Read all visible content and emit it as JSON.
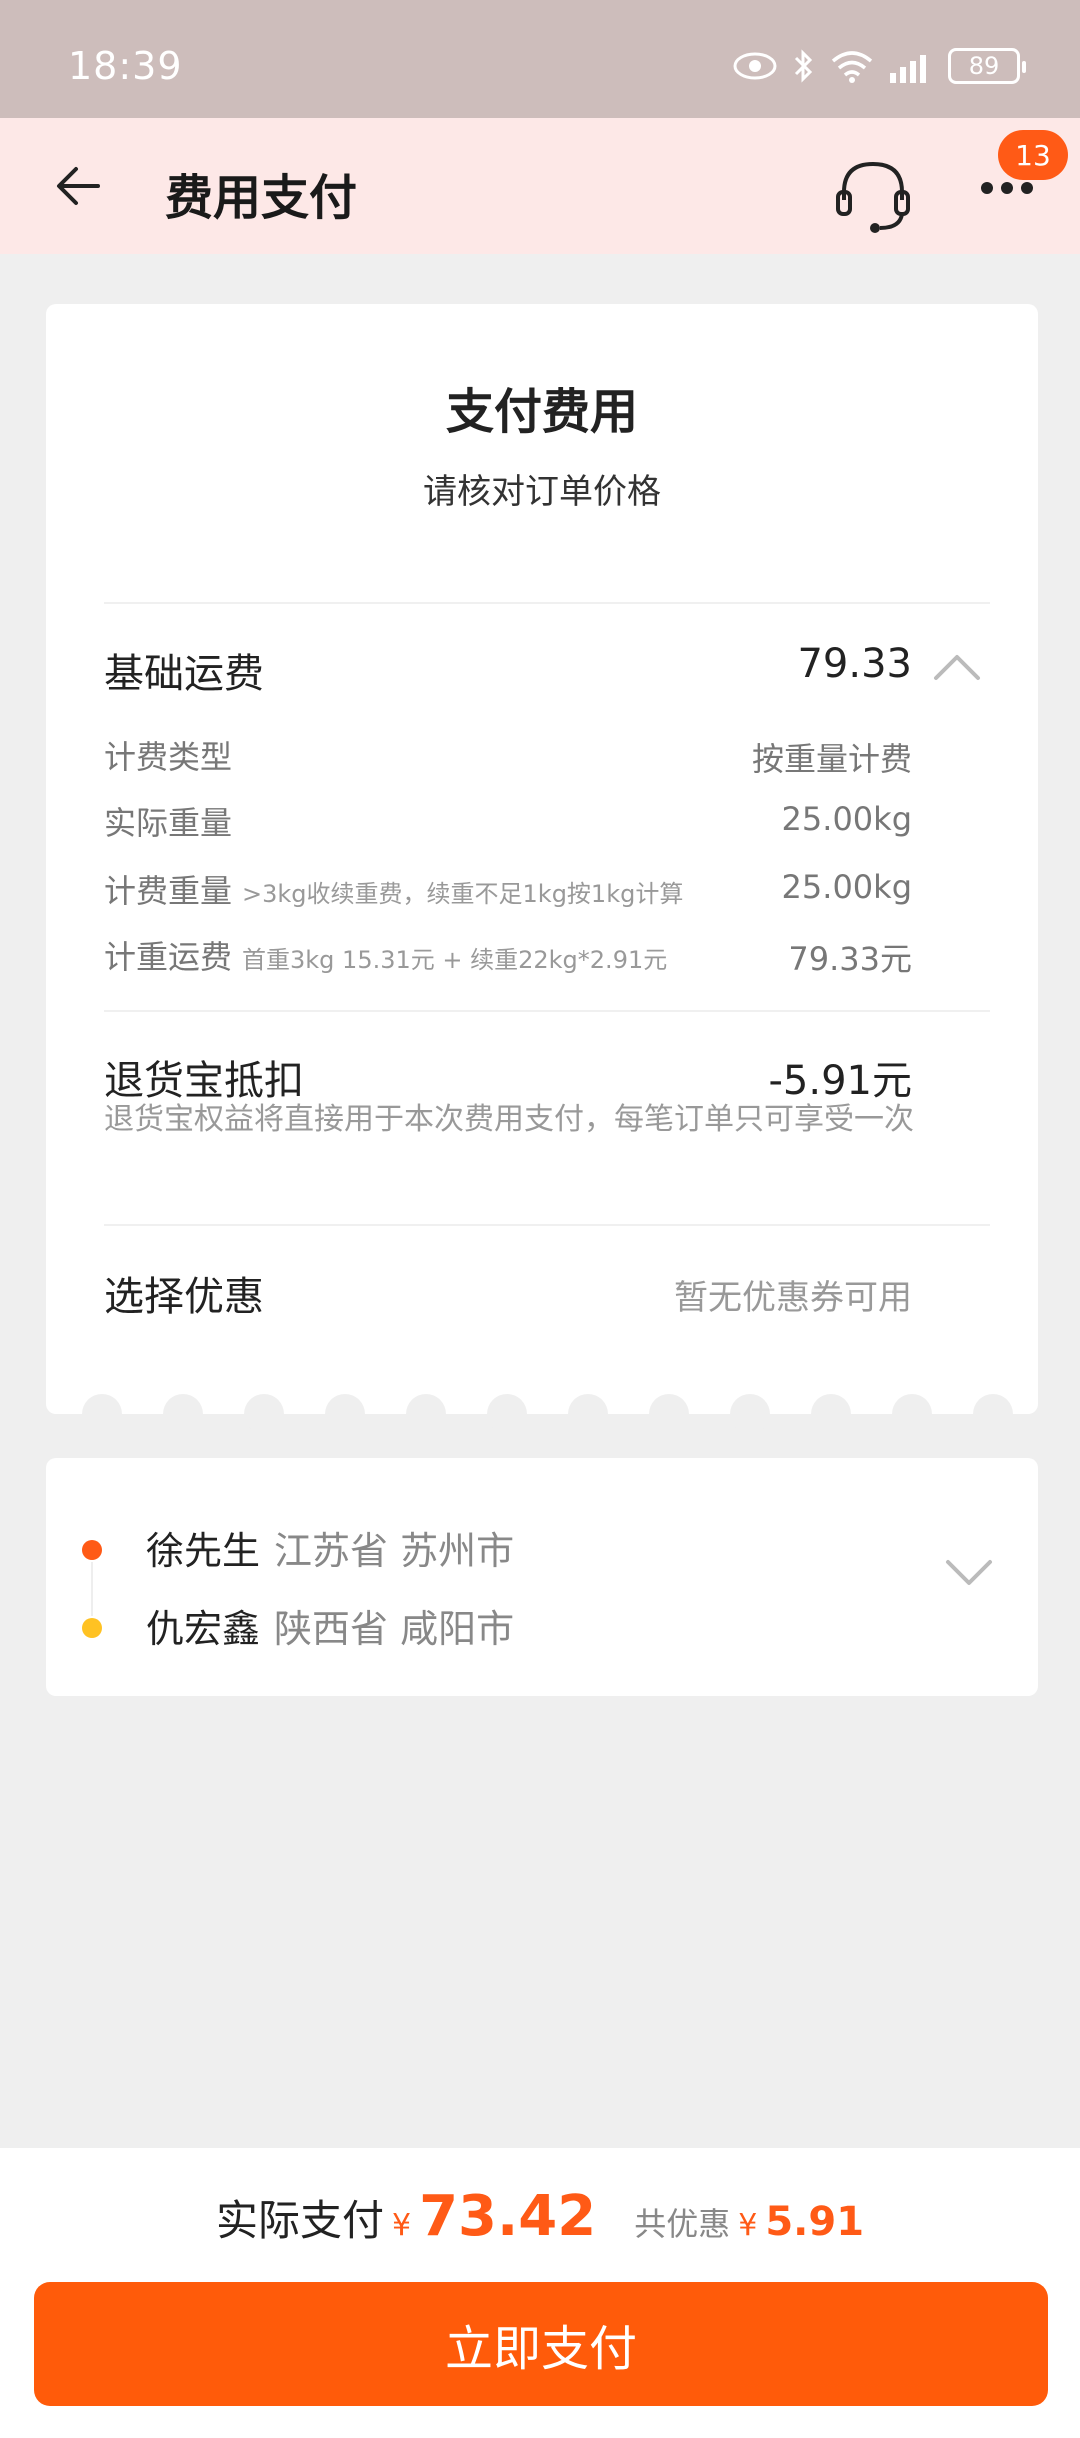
{
  "status_bar": {
    "time": "18:39",
    "battery": "89"
  },
  "header": {
    "title": "费用支付",
    "badge_count": "13"
  },
  "fee_card": {
    "title": "支付费用",
    "subtitle": "请核对订单价格",
    "base_fee": {
      "label": "基础运费",
      "value": "79.33"
    },
    "details": [
      {
        "label": "计费类型",
        "hint": "",
        "value": "按重量计费"
      },
      {
        "label": "实际重量",
        "hint": "",
        "value": "25.00kg"
      },
      {
        "label": "计费重量",
        "hint": ">3kg收续重费，续重不足1kg按1kg计算",
        "value": "25.00kg"
      },
      {
        "label": "计重运费",
        "hint": "首重3kg 15.31元 + 续重22kg*2.91元",
        "value": "79.33元"
      }
    ],
    "return_insurance": {
      "label": "退货宝抵扣",
      "value": "-5.91元",
      "desc": "退货宝权益将直接用于本次费用支付，每笔订单只可享受一次"
    },
    "coupon": {
      "label": "选择优惠",
      "value": "暂无优惠券可用"
    }
  },
  "route": {
    "sender": {
      "name": "徐先生",
      "location": "江苏省 苏州市"
    },
    "receiver": {
      "name": "仇宏鑫",
      "location": "陕西省 咸阳市"
    }
  },
  "footer": {
    "pay_label": "实际支付",
    "currency": "¥",
    "pay_amount": "73.42",
    "discount_label": "共优惠",
    "discount_amount": "5.91",
    "pay_button": "立即支付"
  },
  "colors": {
    "accent": "#ff5b0a",
    "header_bg": "#fde8e7",
    "status_bg": "#cdbdbb"
  }
}
